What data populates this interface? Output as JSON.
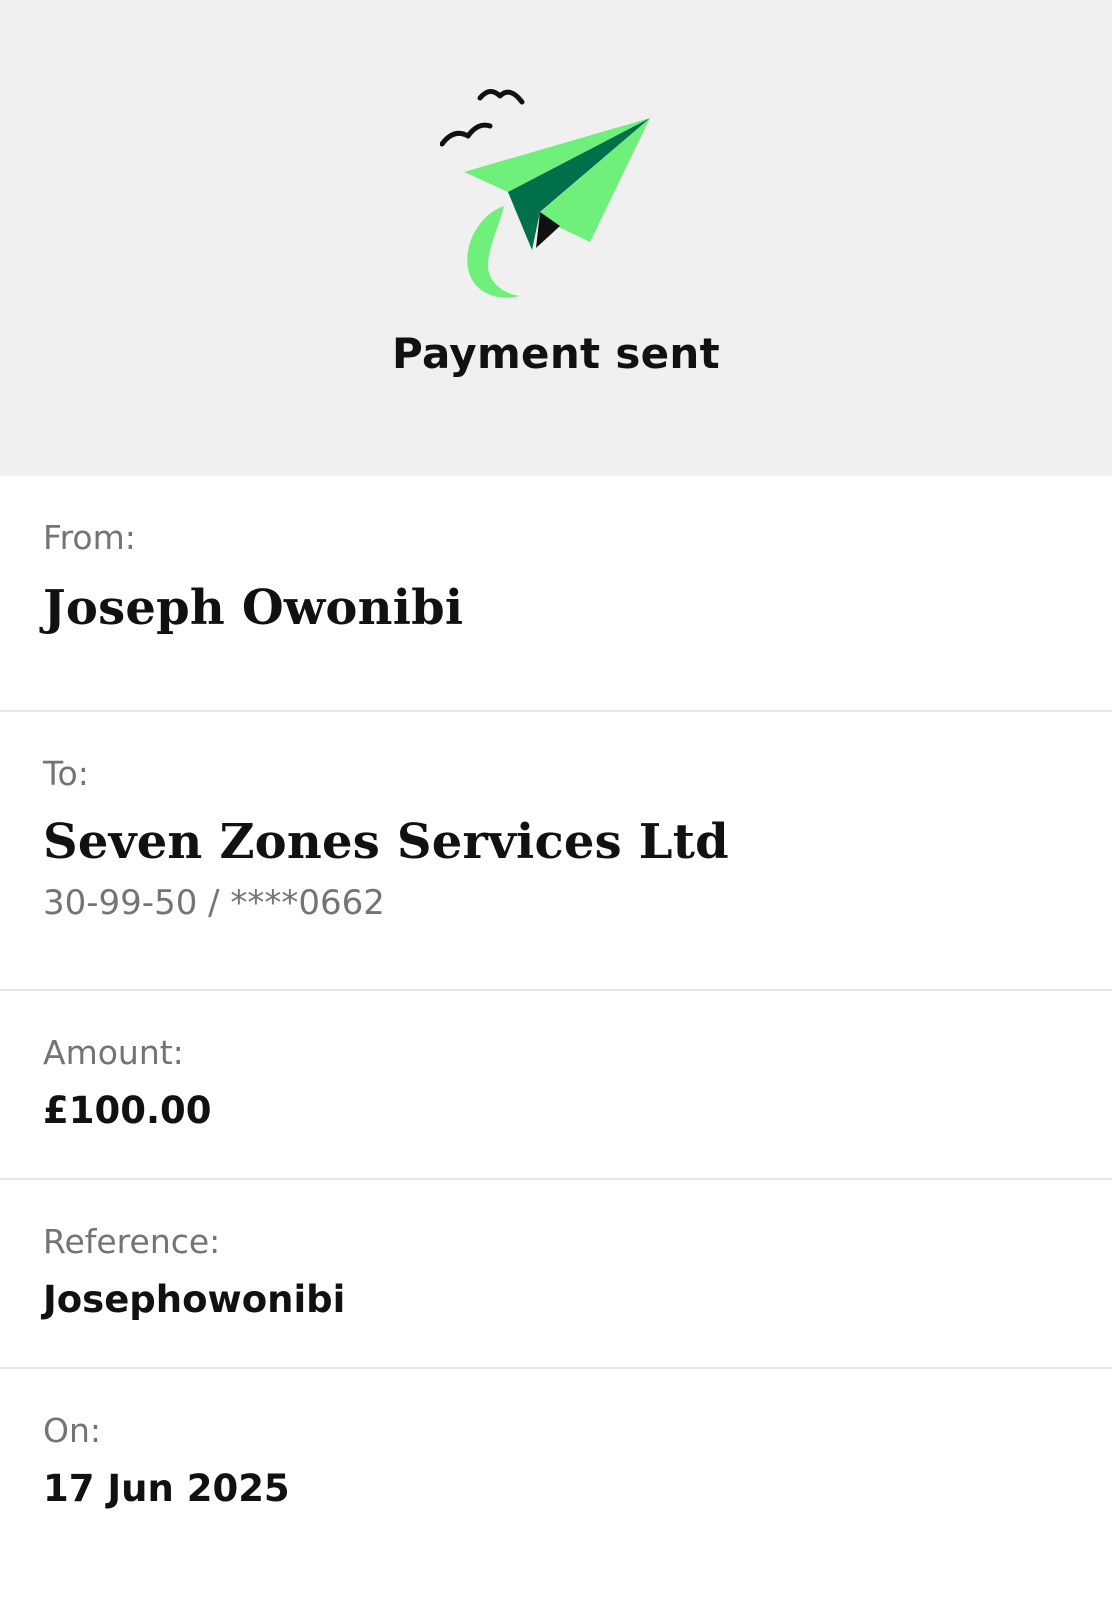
{
  "header": {
    "title": "Payment sent",
    "illustration_icon": "paper-plane-with-birds-icon",
    "colors": {
      "plane_light": "#6EF07B",
      "plane_dark": "#00704A",
      "plane_shadow": "#111111",
      "hero_background": "#F0F0F0"
    }
  },
  "details": {
    "from": {
      "label": "From:",
      "name": "Joseph Owonibi"
    },
    "to": {
      "label": "To:",
      "name": "Seven Zones Services Ltd",
      "account": "30-99-50 / ****0662"
    },
    "amount": {
      "label": "Amount:",
      "value": "£100.00"
    },
    "reference": {
      "label": "Reference:",
      "value": "Josephowonibi"
    },
    "on": {
      "label": "On:",
      "value": "17 Jun 2025"
    }
  }
}
